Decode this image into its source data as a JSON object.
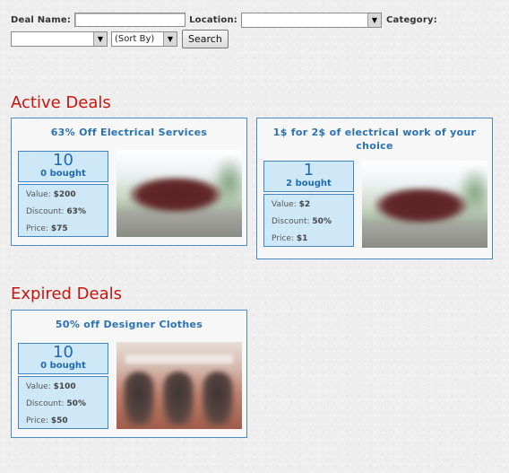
{
  "search": {
    "deal_name_label": "Deal Name:",
    "location_label": "Location:",
    "category_label": "Category:",
    "location_value": "",
    "category_value": "",
    "sort_value": "(Sort By)",
    "search_button": "Search"
  },
  "active_title": "Active Deals",
  "expired_title": "Expired Deals",
  "active_deals": [
    {
      "title": "63% Off Electrical Services",
      "count": "10",
      "bought": "0 bought",
      "value_label": "Value:",
      "value": "$200",
      "discount_label": "Discount:",
      "discount": "63%",
      "price_label": "Price:",
      "price": "$75"
    },
    {
      "title": "1$ for 2$ of electrical work of your choice",
      "count": "1",
      "bought": "2 bought",
      "value_label": "Value:",
      "value": "$2",
      "discount_label": "Discount:",
      "discount": "50%",
      "price_label": "Price:",
      "price": "$1"
    }
  ],
  "expired_deals": [
    {
      "title": "50% off Designer Clothes",
      "count": "10",
      "bought": "0 bought",
      "value_label": "Value:",
      "value": "$100",
      "discount_label": "Discount:",
      "discount": "50%",
      "price_label": "Price:",
      "price": "$50"
    }
  ],
  "icons": {
    "dropdown": "chevron-down-icon"
  },
  "colors": {
    "section_title": "#c8140e",
    "accent": "#2b72b3",
    "box_bg": "#cfe8f8"
  }
}
